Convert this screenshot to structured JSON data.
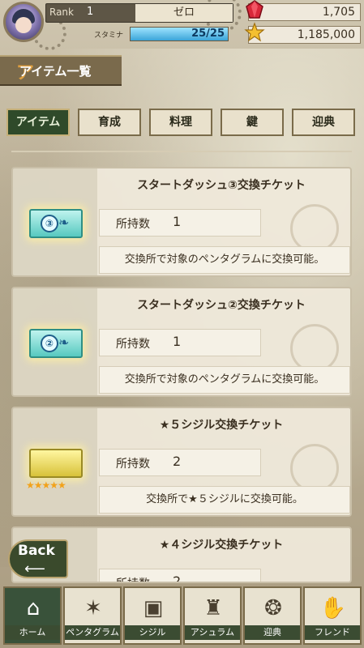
{
  "header": {
    "rank_label": "Rank",
    "rank_value": "1",
    "player_name": "ゼロ",
    "stamina_label": "スタミナ",
    "stamina_current": "25",
    "stamina_max": "25",
    "stamina_text": "25/25",
    "stamina_fraction": 1.0,
    "gems": "1,705",
    "coins": "1,185,000"
  },
  "page": {
    "title": "アイテム一覧"
  },
  "tabs": [
    {
      "label": "アイテム",
      "active": true
    },
    {
      "label": "育成",
      "active": false
    },
    {
      "label": "料理",
      "active": false
    },
    {
      "label": "鍵",
      "active": false
    },
    {
      "label": "迎典",
      "active": false
    }
  ],
  "items": [
    {
      "name": "スタートダッシュ③交換チケット",
      "count_label": "所持数",
      "count": "1",
      "description": "交換所で対象のペンタグラムに交換可能。",
      "ticket_number": "③",
      "icon": "teal-ticket-icon"
    },
    {
      "name": "スタートダッシュ②交換チケット",
      "count_label": "所持数",
      "count": "1",
      "description": "交換所で対象のペンタグラムに交換可能。",
      "ticket_number": "②",
      "icon": "teal-ticket-icon"
    },
    {
      "name": "★５シジル交換チケット",
      "count_label": "所持数",
      "count": "2",
      "description": "交換所で★５シジルに交換可能。",
      "stars": "★★★★★",
      "icon": "gold-ticket-icon"
    },
    {
      "name": "★４シジル交換チケット",
      "count_label": "所持数",
      "count": "2",
      "stars": "★★",
      "icon": "silver-ticket-icon"
    }
  ],
  "back_button": {
    "label": "Back"
  },
  "nav": [
    {
      "label": "ホーム",
      "icon": "home-icon",
      "active": true
    },
    {
      "label": "ペンタグラム",
      "icon": "pentagram-icon",
      "active": false
    },
    {
      "label": "シジル",
      "icon": "sigil-frame-icon",
      "active": false
    },
    {
      "label": "アシュラム",
      "icon": "castle-icon",
      "active": false
    },
    {
      "label": "迎典",
      "icon": "gift-globe-icon",
      "active": false
    },
    {
      "label": "フレンド",
      "icon": "handshake-icon",
      "active": false
    }
  ],
  "colors": {
    "accent_green": "#39523a",
    "stamina_blue": "#3aa4d8",
    "gold": "#f2a21a"
  }
}
